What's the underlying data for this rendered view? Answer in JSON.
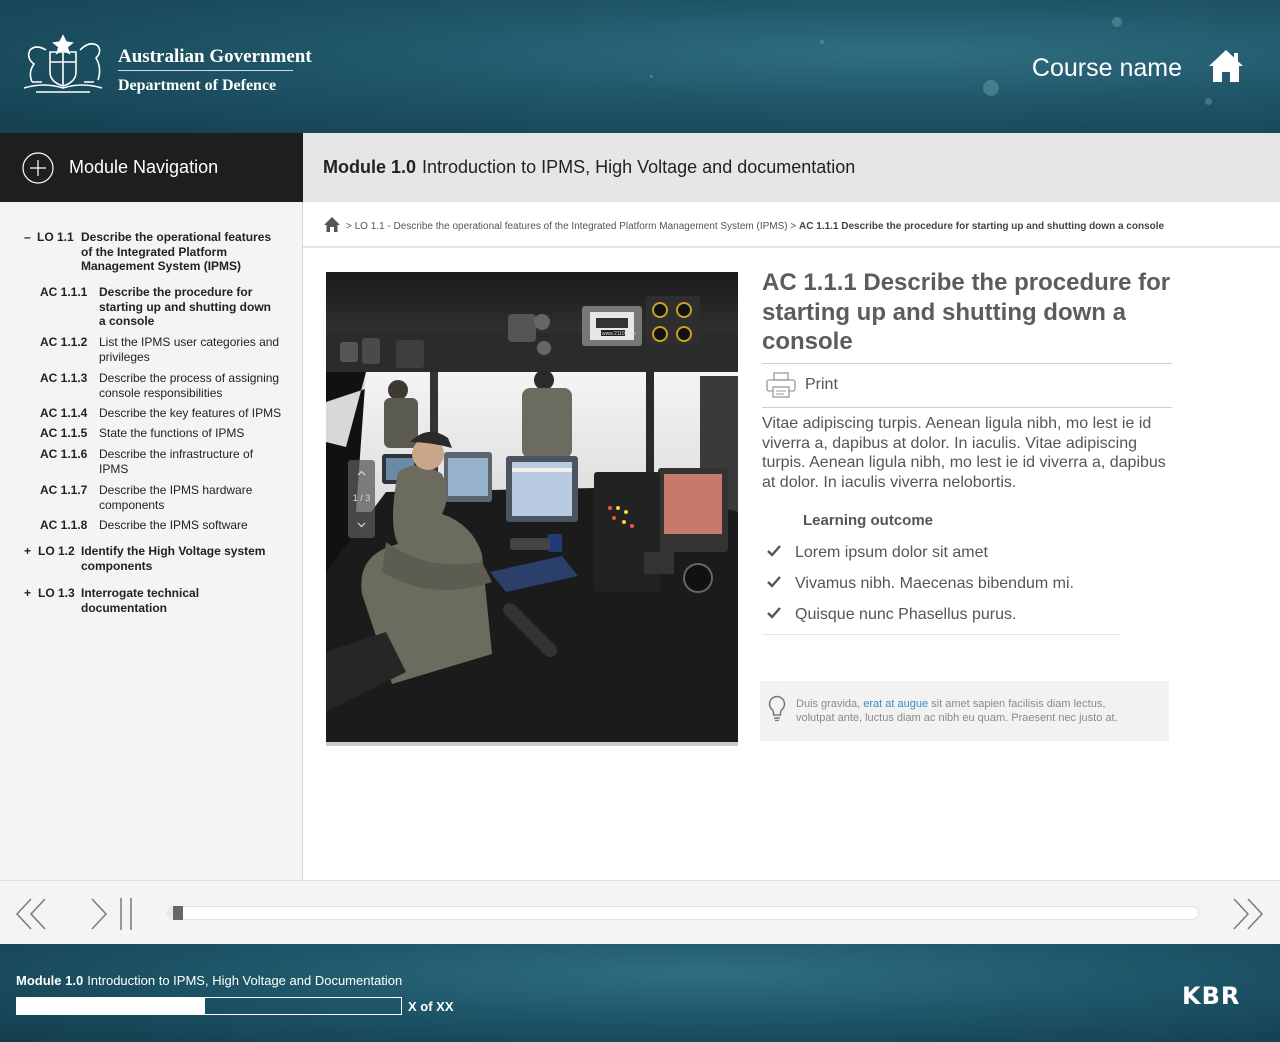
{
  "header": {
    "gov_line1": "Australian Government",
    "gov_line2": "Department of Defence",
    "course_name": "Course name",
    "home_icon": "home-icon"
  },
  "sidebar": {
    "nav_title": "Module Navigation",
    "items": [
      {
        "sym": "–",
        "code": "LO 1.1",
        "text": "Describe the operational features of the Integrated Platform Management System (IPMS)"
      },
      {
        "code": "AC 1.1.1",
        "text": "Describe the procedure for starting up and shutting down a console"
      },
      {
        "code": "AC 1.1.2",
        "text": "List the IPMS user categories and privileges"
      },
      {
        "code": "AC 1.1.3",
        "text": "Describe the process of assigning console responsibilities"
      },
      {
        "code": "AC 1.1.4",
        "text": "Describe the key features of IPMS"
      },
      {
        "code": "AC 1.1.5",
        "text": "State the functions of IPMS"
      },
      {
        "code": "AC 1.1.6",
        "text": "Describe the infrastructure of IPMS"
      },
      {
        "code": "AC 1.1.7",
        "text": "Describe the IPMS hardware components"
      },
      {
        "code": "AC 1.1.8",
        "text": "Describe the IPMS software"
      },
      {
        "sym": "+",
        "code": "LO 1.2",
        "text": "Identify the High Voltage system components"
      },
      {
        "sym": "+",
        "code": "LO 1.3",
        "text": "Interrogate technical documentation"
      }
    ]
  },
  "module": {
    "number": "Module 1.0",
    "title": "Introduction to IPMS, High Voltage and documentation"
  },
  "breadcrumb": {
    "sep1": ">",
    "parent": "LO 1.1 - Describe the operational features of the Integrated Platform Management System (IPMS)",
    "sep2": ">",
    "current": "AC 1.1.1 Describe the procedure for starting up and shutting down a console"
  },
  "image": {
    "counter": "1 / 3",
    "screen_text": "www.2110.com"
  },
  "content": {
    "title": "AC 1.1.1 Describe the procedure for starting up and shutting down a console",
    "print_label": "Print",
    "body": "Vitae adipiscing turpis. Aenean ligula nibh, mo lest ie id viverra a, dapibus at dolor. In iaculis. Vitae adipiscing turpis. Aenean ligula nibh, mo lest ie id viverra a, dapibus at dolor. In iaculis viverra nelobortis.",
    "lo_heading": "Learning outcome",
    "lo_items": [
      "Lorem ipsum dolor sit amet",
      "Vivamus nibh. Maecenas bibendum mi.",
      "Quisque nunc Phasellus purus."
    ],
    "tip_before": "Duis gravida, ",
    "tip_link": "erat at augue",
    "tip_after": " sit amet sapien facilisis diam lectus, volutpat ante, luctus diam ac nibh eu quam. Praesent nec justo at."
  },
  "player": {
    "progress": 0.005
  },
  "footer": {
    "module_number": "Module 1.0",
    "module_title": "Introduction to IPMS, High Voltage and Documentation",
    "progress": 0.49,
    "count": "X of XX",
    "brand": "KBR"
  },
  "colors": {
    "header_teal": "#1f5668",
    "nav_dark": "#1e1e1e",
    "link_blue": "#3a8fc5",
    "title_grey": "#5c5c5c"
  }
}
